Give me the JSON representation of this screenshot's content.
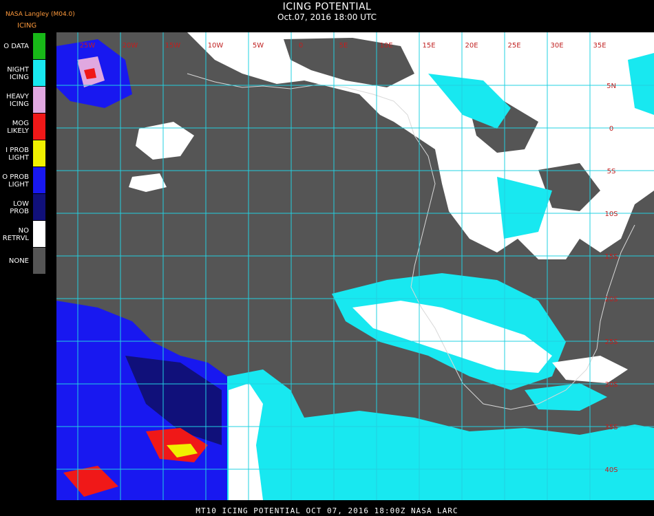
{
  "header": {
    "title": "ICING POTENTIAL",
    "subtitle": "Oct.07, 2016 18:00 UTC",
    "provider": "NASA Langley (M04.0)",
    "legend_title": "ICING"
  },
  "legend": [
    {
      "label": "O DATA",
      "color": "#18b818"
    },
    {
      "label": "NIGHT\nICING",
      "color": "#18e8f0"
    },
    {
      "label": "HEAVY\nICING",
      "color": "#e0a8e0"
    },
    {
      "label": "MOG\nLIKELY",
      "color": "#f01818"
    },
    {
      "label": "I PROB\nLIGHT",
      "color": "#f0f000"
    },
    {
      "label": "O PROB\nLIGHT",
      "color": "#1818f0"
    },
    {
      "label": "LOW\nPROB",
      "color": "#10107a"
    },
    {
      "label": "NO\nRETRVL",
      "color": "#ffffff"
    },
    {
      "label": "NONE",
      "color": "#555555"
    }
  ],
  "map": {
    "background_color": "#555555",
    "grid_color": "#22d0e0",
    "grid_label_color": "#c02020",
    "lon_labels": [
      "25W",
      "20W",
      "15W",
      "10W",
      "5W",
      "0",
      "5E",
      "10E",
      "15E",
      "20E",
      "25E",
      "30E",
      "35E"
    ],
    "lat_labels": [
      "5N",
      "0",
      "5S",
      "10S",
      "15S",
      "20S",
      "25S",
      "30S",
      "35S",
      "40S"
    ]
  },
  "footer": {
    "text": "MT10  ICING POTENTIAL   OCT 07, 2016 18:00Z   NASA LARC"
  }
}
